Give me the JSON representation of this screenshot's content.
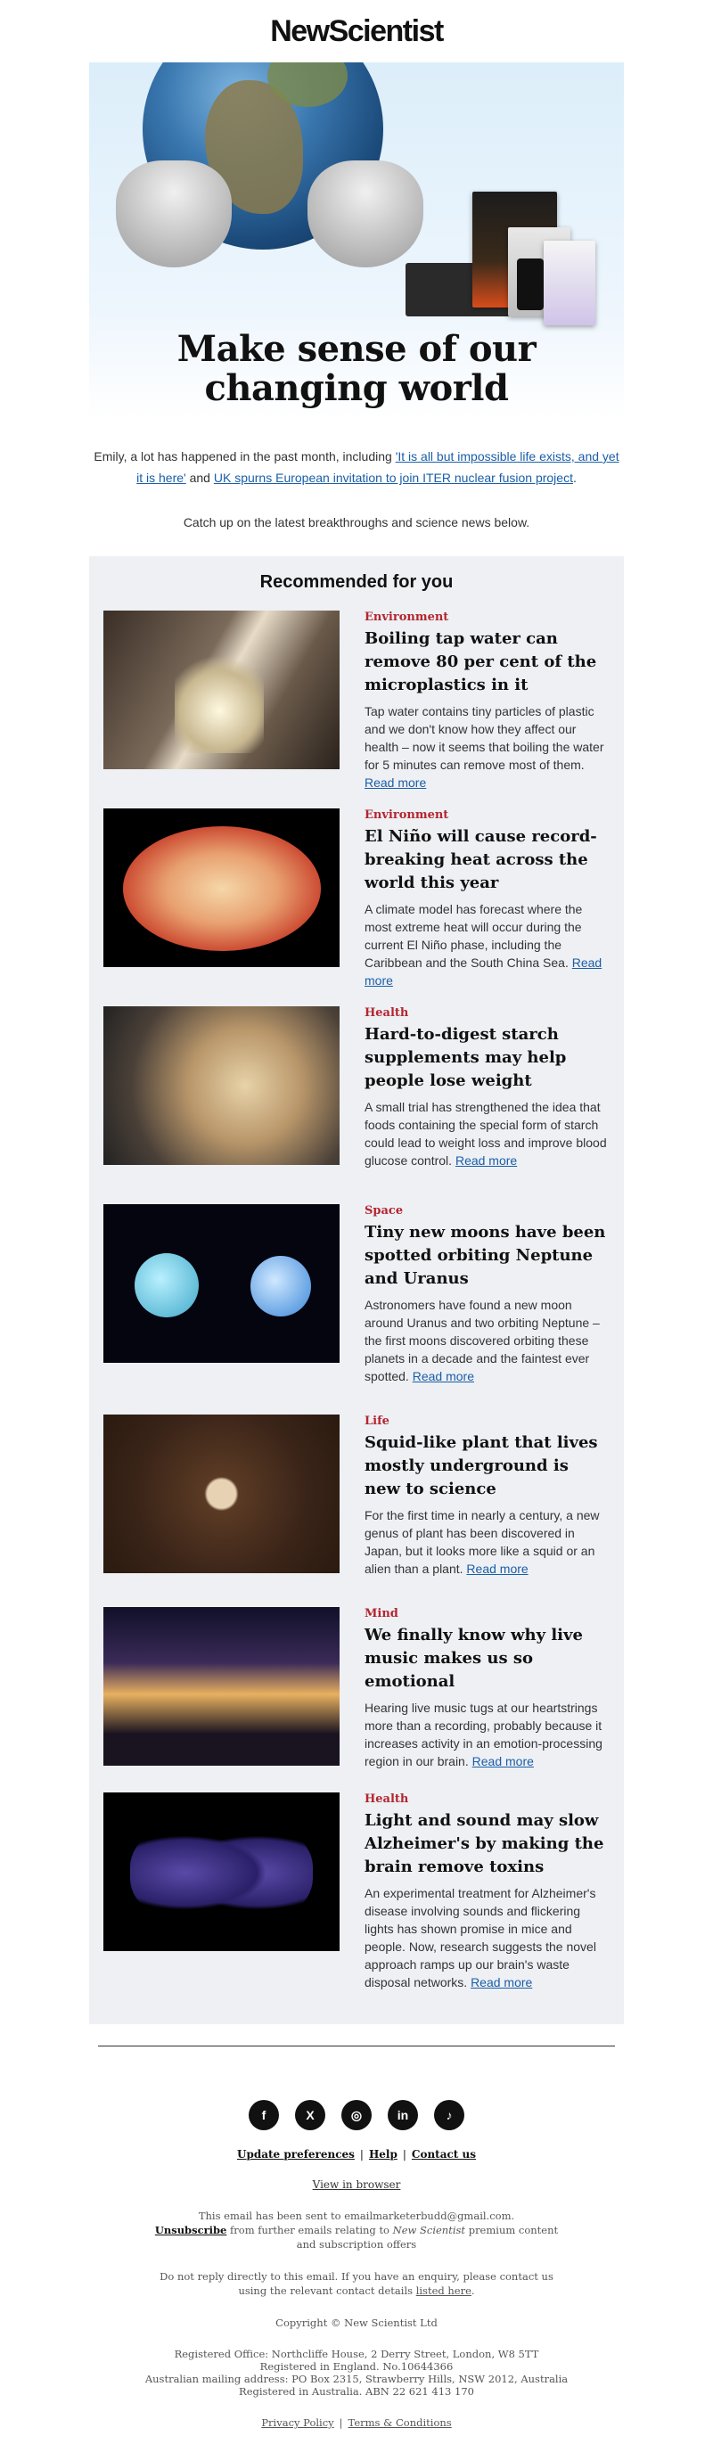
{
  "brand": {
    "logo_text": "NewScientist"
  },
  "hero": {
    "headline_line1": "Make sense of our",
    "headline_line2": "changing world"
  },
  "intro": {
    "prefix": "Emily, a lot has happened in the past month, including ",
    "link1": "'It is all but impossible life exists, and yet it is here'",
    "middle": " and ",
    "link2": "UK spurns European invitation to join ITER nuclear fusion project",
    "suffix": ".",
    "catch_up": "Catch up on the latest breakthroughs and science news below."
  },
  "recommended": {
    "heading": "Recommended for you",
    "read_more": "Read more",
    "articles": [
      {
        "category": "Environment",
        "title": "Boiling tap water can remove 80 per cent of the microplastics in it",
        "description": "Tap water contains tiny particles of plastic and we don't know how they affect our health – now it seems that boiling the water for 5 minutes can remove most of them."
      },
      {
        "category": "Environment",
        "title": "El Niño will cause record-breaking heat across the world this year",
        "description": "A climate model has forecast where the most extreme heat will occur during the current El Niño phase, including the Caribbean and the South China Sea."
      },
      {
        "category": "Health",
        "title": "Hard-to-digest starch supplements may help people lose weight",
        "description": "A small trial has strengthened the idea that foods containing the special form of starch could lead to weight loss and improve blood glucose control."
      },
      {
        "category": "Space",
        "title": "Tiny new moons have been spotted orbiting Neptune and Uranus",
        "description": "Astronomers have found a new moon around Uranus and two orbiting Neptune – the first moons discovered orbiting these planets in a decade and the faintest ever spotted."
      },
      {
        "category": "Life",
        "title": "Squid-like plant that lives mostly underground is new to science",
        "description": "For the first time in nearly a century, a new genus of plant has been discovered in Japan, but it looks more like a squid or an alien than a plant."
      },
      {
        "category": "Mind",
        "title": "We finally know why live music makes us so emotional",
        "description": "Hearing live music tugs at our heartstrings more than a recording, probably because it increases activity in an emotion-processing region in our brain."
      },
      {
        "category": "Health",
        "title": "Light and sound may slow Alzheimer's by making the brain remove toxins",
        "description": "An experimental treatment for Alzheimer's disease involving sounds and flickering lights has shown promise in mice and people. Now, research suggests the novel approach ramps up our brain's waste disposal networks."
      }
    ]
  },
  "footer": {
    "social": [
      {
        "icon": "facebook-icon",
        "glyph": "f"
      },
      {
        "icon": "x-icon",
        "glyph": "X"
      },
      {
        "icon": "instagram-icon",
        "glyph": "◎"
      },
      {
        "icon": "linkedin-icon",
        "glyph": "in"
      },
      {
        "icon": "tiktok-icon",
        "glyph": "♪"
      }
    ],
    "update_preferences": "Update preferences",
    "help": "Help",
    "contact_us": "Contact us",
    "separator": "|",
    "view_in_browser": "View in browser",
    "sent_to": "This email has been sent to emailmarketerbudd@gmail.com.",
    "unsubscribe": "Unsubscribe",
    "unsubscribe_rest_a": " from further emails relating to ",
    "unsubscribe_italic": "New Scientist",
    "unsubscribe_rest_b": " premium content",
    "unsubscribe_line2": "and subscription offers",
    "do_not_reply_1": "Do not reply directly to this email. If you have an enquiry, please contact us",
    "do_not_reply_2_prefix": "using the relevant contact details ",
    "listed_here": "listed here",
    "do_not_reply_2_suffix": ".",
    "copyright": "Copyright © New Scientist Ltd",
    "registered_1": "Registered Office: Northcliffe House, 2 Derry Street, London, W8 5TT",
    "registered_2": "Registered in England. No.10644366",
    "registered_3": "Australian mailing address: PO Box 2315, Strawberry Hills, NSW 2012, Australia",
    "registered_4": "Registered in Australia. ABN 22 621 413 170",
    "privacy_policy": "Privacy Policy",
    "terms": "Terms & Conditions"
  }
}
